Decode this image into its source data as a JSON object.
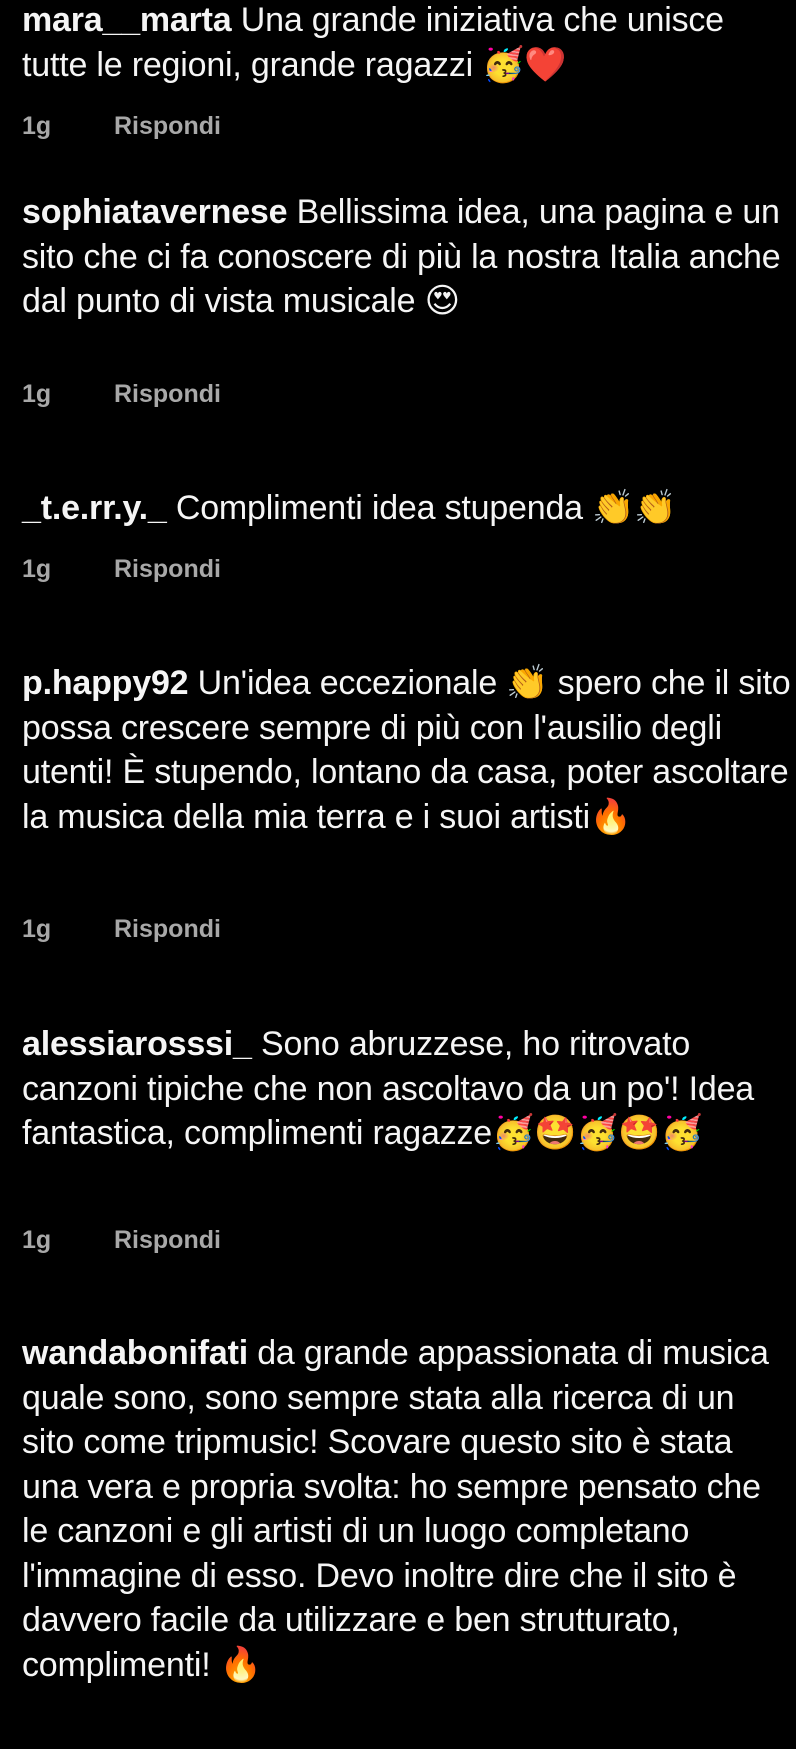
{
  "colors": {
    "background": "#000000",
    "text": "#f5f5f5",
    "meta": "#a8a8a8"
  },
  "comments": [
    {
      "username": "mara__marta",
      "text": "Una grande iniziativa che unisce tutte le regioni, grande ragazzi 🥳❤️",
      "time": "1g",
      "reply_label": "Rispondi"
    },
    {
      "username": "sophiatavernese",
      "text": "Bellissima idea, una pagina e un sito che ci fa conoscere di più la nostra Italia anche dal punto di vista musicale 😍",
      "time": "1g",
      "reply_label": "Rispondi"
    },
    {
      "username": "_t.e.rr.y._",
      "text": "Complimenti idea stupenda 👏👏",
      "time": "1g",
      "reply_label": "Rispondi"
    },
    {
      "username": "p.happy92",
      "text": "Un'idea eccezionale 👏 spero che il sito possa crescere sempre di più con l'ausilio degli utenti! È stupendo, lontano da casa, poter ascoltare la musica della mia terra e i suoi artisti🔥",
      "time": "1g",
      "reply_label": "Rispondi"
    },
    {
      "username": "alessiarosssi_",
      "text": "Sono abruzzese, ho ritrovato canzoni tipiche che non ascoltavo da un po'! Idea fantastica, complimenti ragazze🥳🤩🥳🤩🥳",
      "time": "1g",
      "reply_label": "Rispondi"
    },
    {
      "username": "wandabonifati",
      "text": "da grande appassionata di musica quale sono, sono sempre stata alla ricerca di un sito come tripmusic! Scovare questo sito è stata una vera e propria svolta: ho sempre pensato che le canzoni e gli artisti di un luogo completano l'immagine di esso. Devo inoltre dire che il sito è davvero facile da utilizzare e ben strutturato, complimenti! 🔥"
    }
  ]
}
